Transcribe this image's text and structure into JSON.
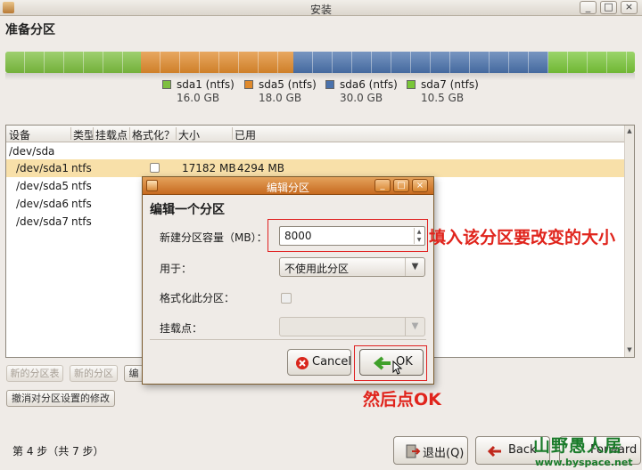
{
  "window": {
    "title": "安装",
    "buttons": [
      "_",
      "□",
      "×"
    ]
  },
  "page_heading": "准备分区",
  "partition_bar": [
    {
      "name": "sda1 (ntfs)",
      "size": "16.0 GB",
      "color": "#7dbf3f"
    },
    {
      "name": "sda5 (ntfs)",
      "size": "18.0 GB",
      "color": "#e08a2c"
    },
    {
      "name": "sda6 (ntfs)",
      "size": "30.0 GB",
      "color": "#4a72ac"
    },
    {
      "name": "sda7 (ntfs)",
      "size": "10.5 GB",
      "color": "#79c638"
    }
  ],
  "table": {
    "columns": [
      "设备",
      "类型",
      "挂载点",
      "格式化？",
      "大小",
      "已用"
    ],
    "rows": [
      {
        "device": "/dev/sda",
        "type": "",
        "size": "",
        "used": ""
      },
      {
        "device": "/dev/sda1",
        "type": "ntfs",
        "size": "17182 MB",
        "used": "4294 MB"
      },
      {
        "device": "/dev/sda5",
        "type": "ntfs",
        "size": "",
        "used": ""
      },
      {
        "device": "/dev/sda6",
        "type": "ntfs",
        "size": "",
        "used": ""
      },
      {
        "device": "/dev/sda7",
        "type": "ntfs",
        "size": "",
        "used": ""
      }
    ]
  },
  "actions": {
    "new_table": "新的分区表",
    "new_partition": "新的分区",
    "edit_partition": "编",
    "revert": "撤消对分区设置的修改"
  },
  "footer": {
    "step": "第 4 步（共 7 步）",
    "quit": "退出(Q)",
    "back": "Back",
    "forward": "Forward"
  },
  "dialog": {
    "title": "编辑分区",
    "heading": "编辑一个分区",
    "size_label": "新建分区容量（MB）：",
    "size_value": "8000",
    "use_label": "用于：",
    "use_value": "不使用此分区",
    "format_label": "格式化此分区：",
    "mount_label": "挂载点：",
    "mount_value": "",
    "cancel": "Cancel",
    "ok": "OK"
  },
  "annotations": {
    "size_note": "填入该分区要改变的大小",
    "ok_note": "然后点OK"
  },
  "watermark": {
    "logo": "山野愚人居",
    "url": "www.byspace.net"
  },
  "colors": {
    "selected_row": "#f8e0a9",
    "dialog_titlebar": "#d8822e",
    "annotation": "#e0241c"
  }
}
